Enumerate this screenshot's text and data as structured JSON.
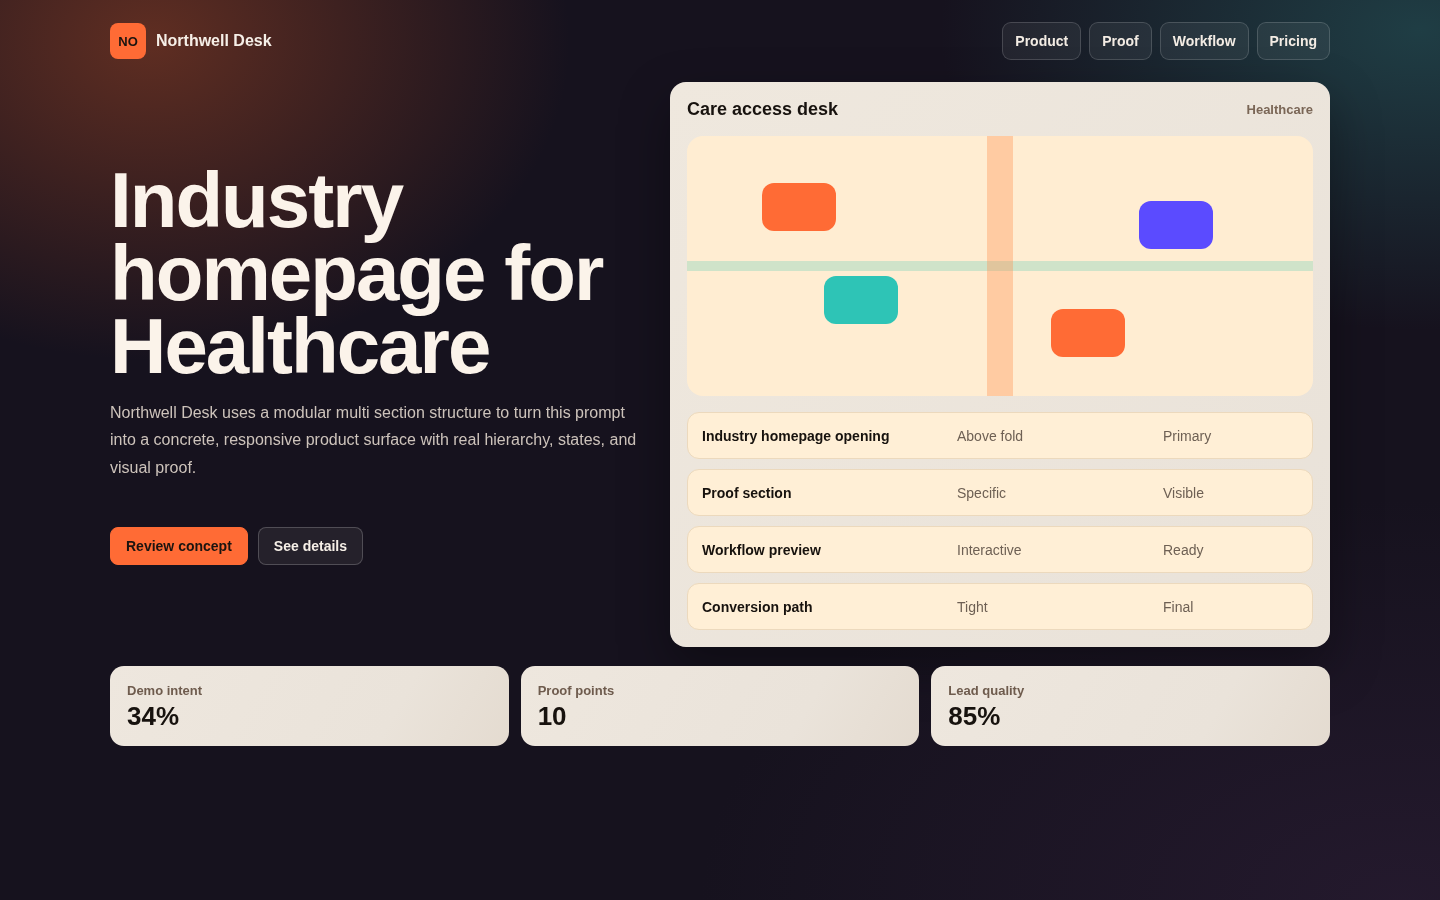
{
  "brand": {
    "mark": "NO",
    "name": "Northwell Desk"
  },
  "nav": [
    "Product",
    "Proof",
    "Workflow",
    "Pricing"
  ],
  "hero": {
    "title": "Industry homepage for Healthcare",
    "description": "Northwell Desk uses a modular multi section structure to turn this prompt into a concrete, responsive product surface with real hierarchy, states, and visual proof.",
    "actions": [
      {
        "label": "Review concept",
        "kind": "primary"
      },
      {
        "label": "See details",
        "kind": "secondary"
      }
    ]
  },
  "panel": {
    "title": "Care access desk",
    "tag": "Healthcare",
    "rows": [
      {
        "label": "Industry homepage opening",
        "column_2": "Above fold",
        "column_3": "Primary"
      },
      {
        "label": "Proof section",
        "column_2": "Specific",
        "column_3": "Visible"
      },
      {
        "label": "Workflow preview",
        "column_2": "Interactive",
        "column_3": "Ready"
      },
      {
        "label": "Conversion path",
        "column_2": "Tight",
        "column_3": "Final"
      }
    ]
  },
  "stats": [
    {
      "label": "Demo intent",
      "value": "34%"
    },
    {
      "label": "Proof points",
      "value": "10"
    },
    {
      "label": "Lead quality",
      "value": "85%"
    }
  ]
}
